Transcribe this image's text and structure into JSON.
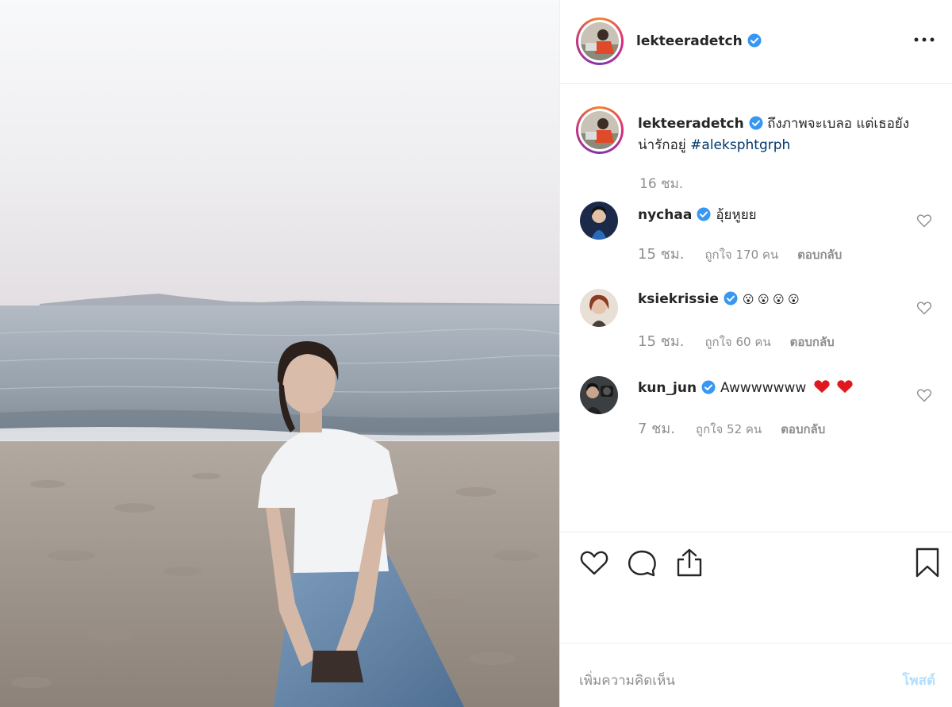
{
  "post": {
    "author": "lekteeradetch",
    "caption": "ถึงภาพจะเบลอ แต่เธอยังน่ารักอยู่",
    "hashtag": "#aleksphtgrph",
    "caption_time": "16 ชม."
  },
  "comments": [
    {
      "user": "nychaa",
      "text": "อุ้ยหูยย",
      "time": "15 ชม.",
      "likes": "ถูกใจ 170 คน",
      "reply": "ตอบกลับ"
    },
    {
      "user": "ksiekrissie",
      "text": "😮 😮 😮 😮",
      "time": "15 ชม.",
      "likes": "ถูกใจ 60 คน",
      "reply": "ตอบกลับ"
    },
    {
      "user": "kun_jun",
      "text": "Awwwwwww",
      "time": "7 ชม.",
      "likes": "ถูกใจ 52 คน",
      "reply": "ตอบกลับ"
    }
  ],
  "add_comment": {
    "placeholder": "เพิ่มความคิดเห็น",
    "post_label": "โพสต์"
  },
  "icons": {
    "more": "ellipsis-icon",
    "verified": "verified-badge-icon",
    "like": "heart-icon",
    "comment": "comment-bubble-icon",
    "share": "share-icon",
    "save": "bookmark-icon"
  },
  "colors": {
    "verified": "#3897f0",
    "link": "#00376b",
    "post_disabled": "#b2dffc",
    "heart_red": "#e0191f"
  }
}
